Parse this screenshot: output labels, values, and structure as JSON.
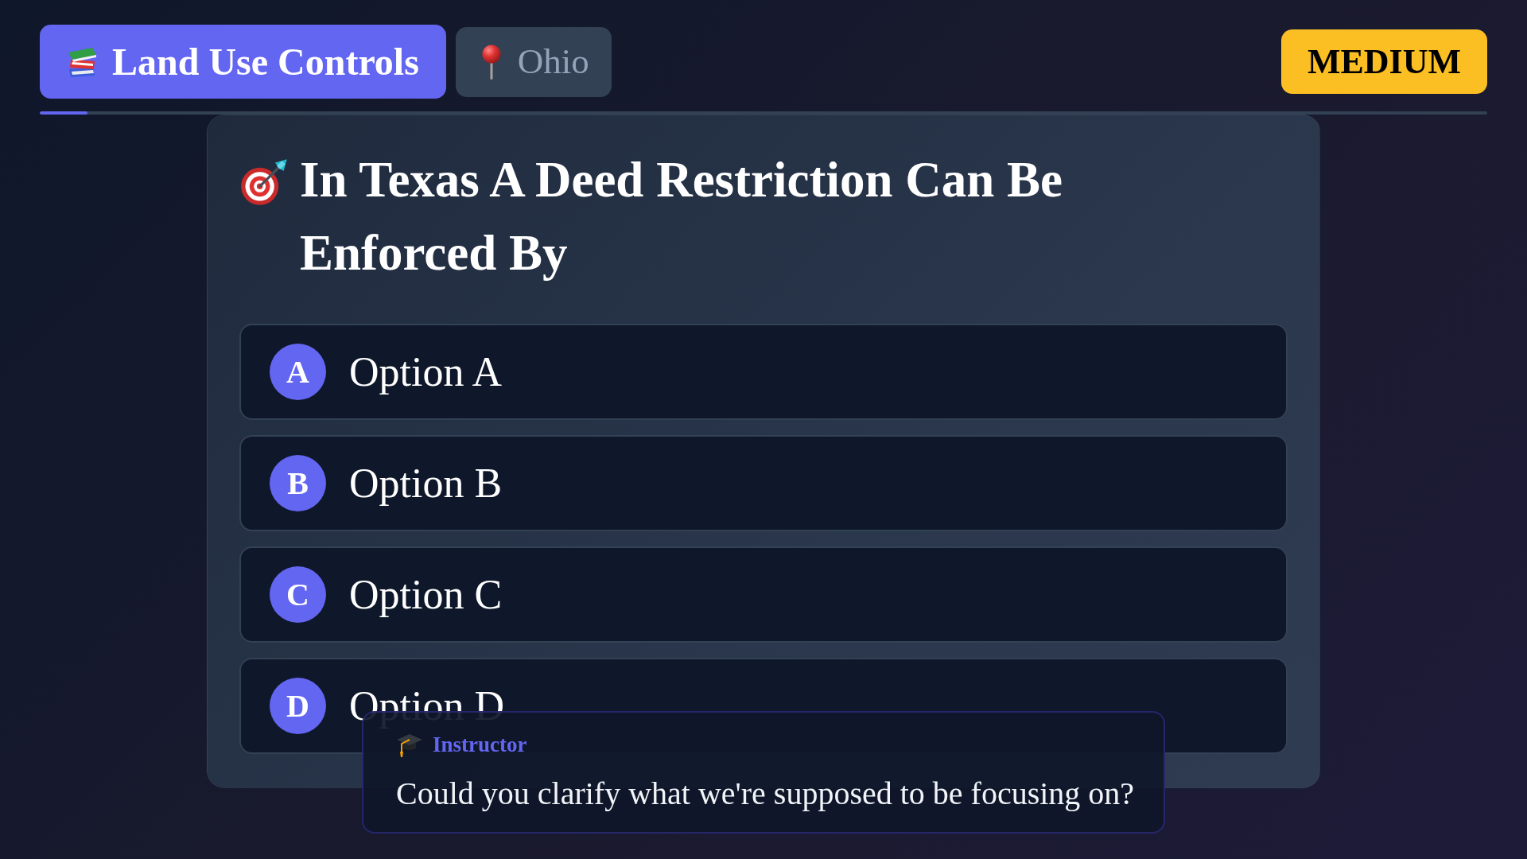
{
  "topic": {
    "label": "Land Use Controls"
  },
  "location": {
    "label": "Ohio"
  },
  "difficulty": {
    "label": "MEDIUM"
  },
  "progress": {
    "level": 0.033
  },
  "question": {
    "title": "In Texas A Deed Restriction Can Be Enforced By",
    "options": [
      {
        "letter": "A",
        "text": "Option A",
        "selected": false
      },
      {
        "letter": "B",
        "text": "Option B",
        "selected": false
      },
      {
        "letter": "C",
        "text": "Option C",
        "selected": false
      },
      {
        "letter": "D",
        "text": "Option D",
        "selected": false
      }
    ]
  },
  "chat_bubble": {
    "sender": "Instructor",
    "message": "Could you clarify what we're supposed to be focusing on?"
  }
}
